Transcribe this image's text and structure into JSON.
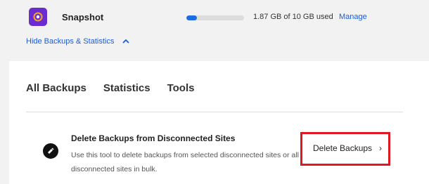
{
  "header": {
    "app_name": "Snapshot",
    "storage_text": "1.87 GB of 10 GB used",
    "storage_used_fraction": 0.187,
    "manage_label": "Manage",
    "toggle_label": "Hide Backups & Statistics"
  },
  "tabs": [
    {
      "label": "All Backups"
    },
    {
      "label": "Statistics"
    },
    {
      "label": "Tools"
    }
  ],
  "tool": {
    "title": "Delete Backups from Disconnected Sites",
    "description": "Use this tool to delete backups from selected disconnected sites or all disconnected sites in bulk.",
    "button_label": "Delete Backups",
    "button_chevron": "›"
  },
  "colors": {
    "accent": "#1f5bd6",
    "app_icon": "#6a2bd0",
    "highlight": "#e01824"
  },
  "icons": {
    "app": "snapshot-app-icon",
    "toggle": "chevron-up-icon",
    "tool": "eraser-icon"
  }
}
